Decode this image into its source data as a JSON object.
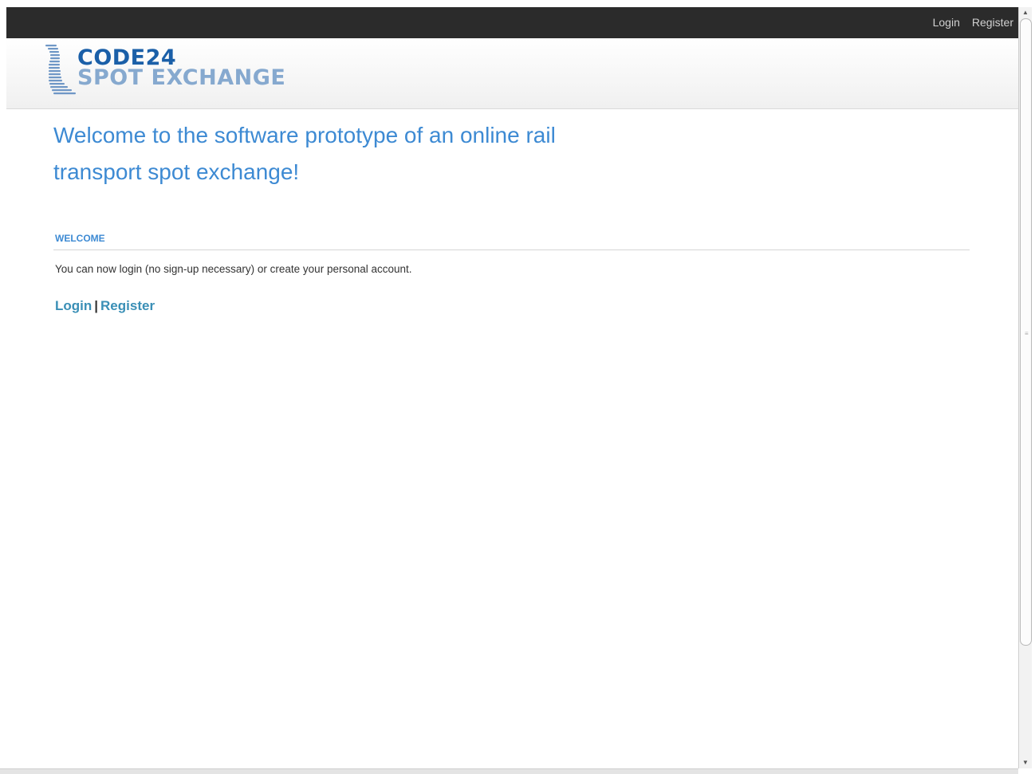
{
  "topbar": {
    "login_label": "Login",
    "register_label": "Register"
  },
  "logo": {
    "line1": "CODE24",
    "line2": "SPOT EXCHANGE",
    "colors": {
      "primary": "#1a5fa8",
      "secondary": "#86a9cf"
    }
  },
  "main": {
    "title": "Welcome to the software prototype of an online rail transport spot exchange!",
    "section_heading": "WELCOME",
    "intro_text": "You can now login (no sign-up necessary) or create your personal account.",
    "links": {
      "login_label": "Login",
      "separator": "|",
      "register_label": "Register"
    }
  },
  "colors": {
    "topbar_bg": "#2b2b2b",
    "accent": "#3d8ad3",
    "link": "#3a8fb6"
  },
  "icons": {
    "scroll_up": "arrow-up-icon",
    "scroll_down": "arrow-down-icon"
  }
}
